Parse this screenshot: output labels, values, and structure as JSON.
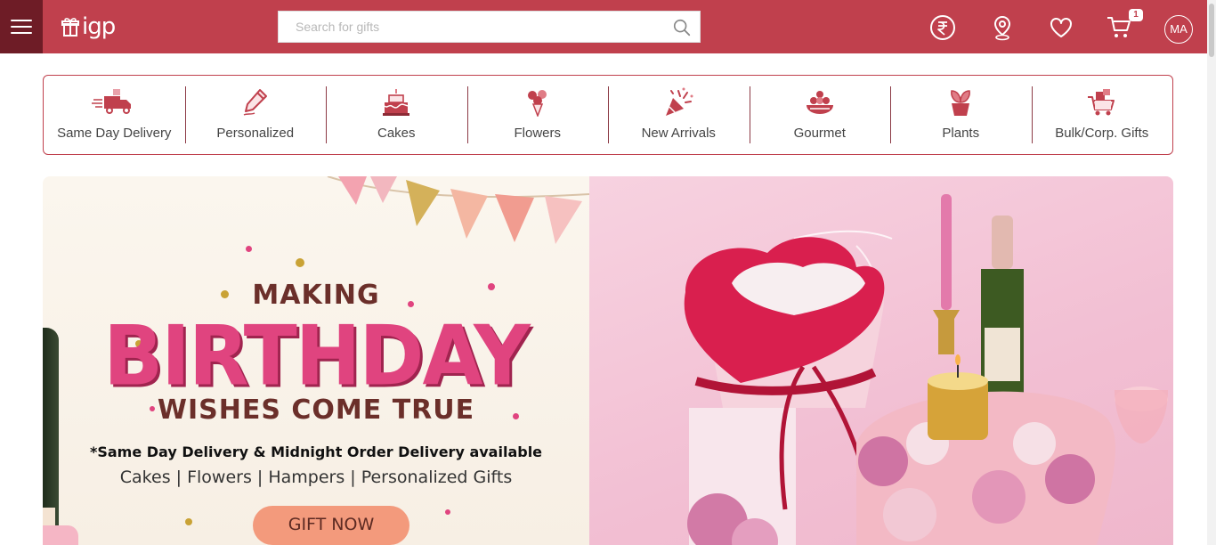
{
  "header": {
    "logo_text": "igp",
    "search": {
      "placeholder": "Search for gifts"
    },
    "icons": [
      "menu-icon",
      "rupee-currency-icon",
      "location-pin-icon",
      "heart-icon",
      "cart-icon"
    ],
    "cart_count": "1",
    "avatar_initials": "MA",
    "brand_color": "#c0404d",
    "menu_bg_color": "#6e1c26"
  },
  "categories": [
    {
      "label": "Same Day Delivery",
      "icon": "delivery-truck-icon"
    },
    {
      "label": "Personalized",
      "icon": "pencil-icon"
    },
    {
      "label": "Cakes",
      "icon": "cake-icon"
    },
    {
      "label": "Flowers",
      "icon": "flower-bouquet-icon"
    },
    {
      "label": "New Arrivals",
      "icon": "party-popper-icon"
    },
    {
      "label": "Gourmet",
      "icon": "gourmet-platter-icon"
    },
    {
      "label": "Plants",
      "icon": "potted-plant-icon"
    },
    {
      "label": "Bulk/Corp. Gifts",
      "icon": "gift-cart-icon"
    }
  ],
  "banner": {
    "line1": "MAKING",
    "line2": "BIRTHDAY",
    "line3": "WISHES COME TRUE",
    "delivery_note": "*Same Day Delivery & Midnight Order Delivery available",
    "categories_line": "Cakes | Flowers | Hampers | Personalized Gifts",
    "cta_label": "GIFT NOW",
    "cta_color": "#f39a7c"
  }
}
